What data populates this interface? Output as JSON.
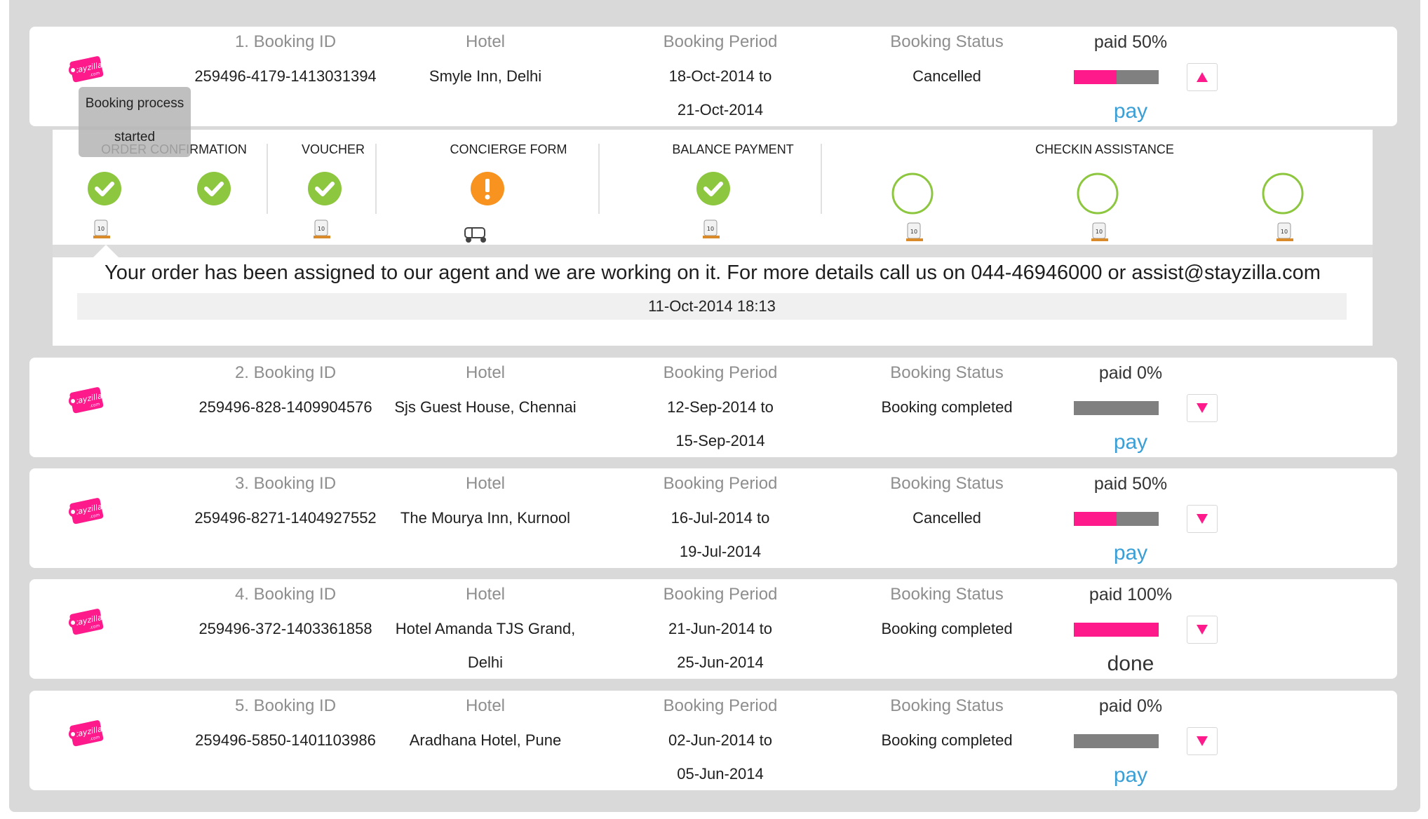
{
  "brand": {
    "logo_text": "Stayzilla",
    "logo_sub": ".com"
  },
  "colors": {
    "accent": "#ff1a8c",
    "bar_bg": "#808080",
    "pay_link": "#3a9fd6",
    "check_green": "#8dc63f",
    "warning_orange": "#f7931e"
  },
  "bookings": [
    {
      "id_header": "1. Booking ID",
      "booking_id": "259496-4179-1413031394",
      "hotel_header": "Hotel",
      "hotel_line1": "Smyle Inn, Delhi",
      "hotel_line2": "",
      "period_header": "Booking Period",
      "period_from": "18-Oct-2014 to",
      "period_to": "21-Oct-2014",
      "status_header": "Booking Status",
      "status": "Cancelled",
      "paid_label": "paid 50%",
      "paid_fraction": 0.5,
      "action": "pay",
      "expanded": true
    },
    {
      "id_header": "2. Booking ID",
      "booking_id": "259496-828-1409904576",
      "hotel_header": "Hotel",
      "hotel_line1": "Sjs Guest House, Chennai",
      "hotel_line2": "",
      "period_header": "Booking Period",
      "period_from": "12-Sep-2014 to",
      "period_to": "15-Sep-2014",
      "status_header": "Booking Status",
      "status": "Booking completed",
      "paid_label": "paid 0%",
      "paid_fraction": 0,
      "action": "pay",
      "expanded": false
    },
    {
      "id_header": "3. Booking ID",
      "booking_id": "259496-8271-1404927552",
      "hotel_header": "Hotel",
      "hotel_line1": "The Mourya Inn, Kurnool",
      "hotel_line2": "",
      "period_header": "Booking Period",
      "period_from": "16-Jul-2014 to",
      "period_to": "19-Jul-2014",
      "status_header": "Booking Status",
      "status": "Cancelled",
      "paid_label": "paid 50%",
      "paid_fraction": 0.5,
      "action": "pay",
      "expanded": false
    },
    {
      "id_header": "4. Booking ID",
      "booking_id": "259496-372-1403361858",
      "hotel_header": "Hotel",
      "hotel_line1": "Hotel Amanda TJS Grand,",
      "hotel_line2": "Delhi",
      "period_header": "Booking Period",
      "period_from": "21-Jun-2014 to",
      "period_to": "25-Jun-2014",
      "status_header": "Booking Status",
      "status": "Booking completed",
      "paid_label": "paid 100%",
      "paid_fraction": 1,
      "action": "done",
      "expanded": false
    },
    {
      "id_header": "5. Booking ID",
      "booking_id": "259496-5850-1401103986",
      "hotel_header": "Hotel",
      "hotel_line1": "Aradhana Hotel, Pune",
      "hotel_line2": "",
      "period_header": "Booking Period",
      "period_from": "02-Jun-2014 to",
      "period_to": "05-Jun-2014",
      "status_header": "Booking Status",
      "status": "Booking completed",
      "paid_label": "paid 0%",
      "paid_fraction": 0,
      "action": "pay",
      "expanded": false
    }
  ],
  "tracker": {
    "stages": [
      "ORDER CONFIRMATION",
      "VOUCHER",
      "CONCIERGE FORM",
      "BALANCE PAYMENT",
      "CHECKIN ASSISTANCE"
    ],
    "step_states": [
      "done",
      "done",
      "done",
      "warning",
      "done",
      "pending",
      "pending",
      "pending"
    ],
    "day_badge": "10",
    "tooltip": "Booking process started",
    "message": "Your order has been assigned to our agent and we are working on it. For more details call us on 044-46946000 or assist@stayzilla.com",
    "message_time": "11-Oct-2014 18:13"
  }
}
